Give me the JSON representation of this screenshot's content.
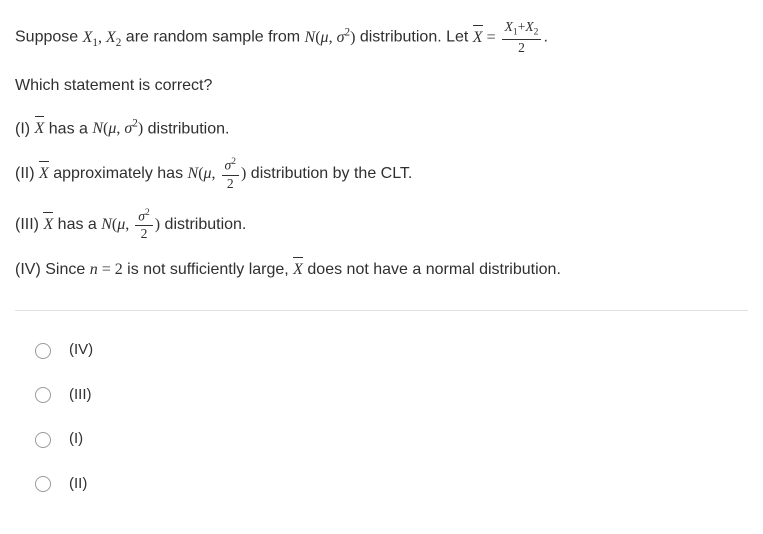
{
  "question": {
    "intro1": "Suppose ",
    "intro2": " are random sample from ",
    "intro3": " distribution. Let ",
    "period": ".",
    "asking": "Which statement is correct?",
    "x1": "X",
    "x1sub": "1",
    "comma1": ", ",
    "x2": "X",
    "x2sub": "2",
    "N": "N",
    "lparen": "(",
    "mu": "μ",
    "comma2": ", ",
    "sigma": "σ",
    "sq": "2",
    "rparen": ")",
    "xbar": "X",
    "equals": " = ",
    "frac_num_x1": "X",
    "frac_num_sub1": "1",
    "frac_plus": "+",
    "frac_num_x2": "X",
    "frac_num_sub2": "2",
    "frac_den": "2"
  },
  "statements": {
    "s1": {
      "label": "(I) ",
      "text1": " has a ",
      "text2": " distribution."
    },
    "s2": {
      "label": "(II) ",
      "text1": " approximately has  ",
      "text2": " distribution by the CLT."
    },
    "s3": {
      "label": "(III) ",
      "text1": " has a ",
      "text2": " distribution."
    },
    "s4": {
      "label": "(IV) Since ",
      "n": "n",
      "eq": " = ",
      "two": "2",
      "text1": " is not sufficiently large, ",
      "text2": " does not have a normal distribution."
    },
    "half_den": "2"
  },
  "options": {
    "opt1": "(IV)",
    "opt2": "(III)",
    "opt3": "(I)",
    "opt4": "(II)"
  }
}
